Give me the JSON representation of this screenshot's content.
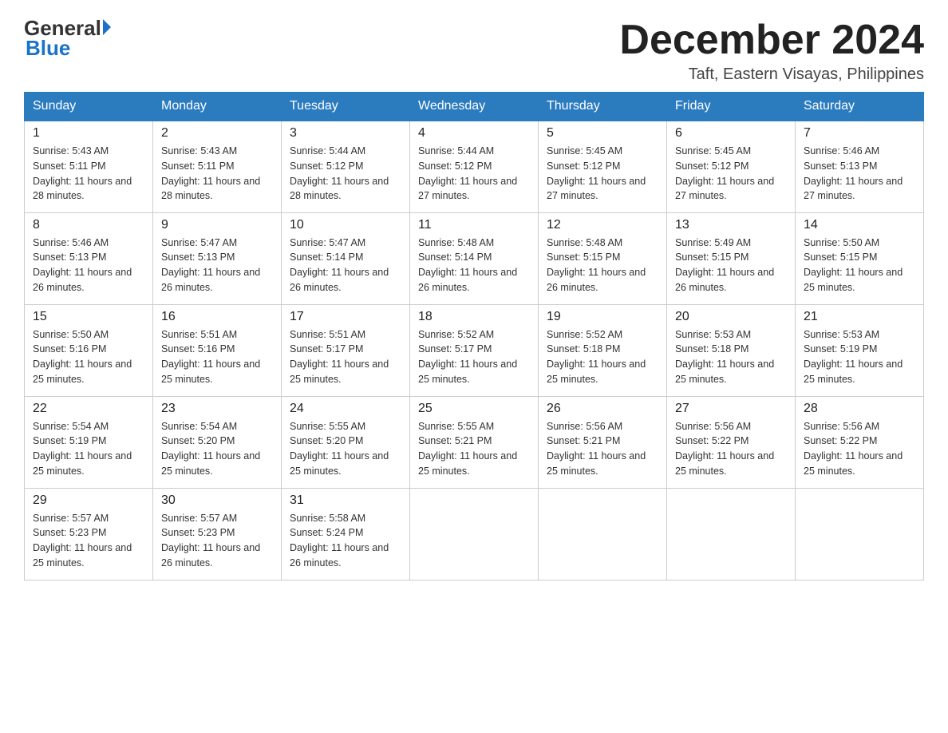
{
  "header": {
    "logo_general": "General",
    "logo_blue": "Blue",
    "month_title": "December 2024",
    "location": "Taft, Eastern Visayas, Philippines"
  },
  "calendar": {
    "days_of_week": [
      "Sunday",
      "Monday",
      "Tuesday",
      "Wednesday",
      "Thursday",
      "Friday",
      "Saturday"
    ],
    "weeks": [
      [
        {
          "day": "1",
          "sunrise": "5:43 AM",
          "sunset": "5:11 PM",
          "daylight": "11 hours and 28 minutes."
        },
        {
          "day": "2",
          "sunrise": "5:43 AM",
          "sunset": "5:11 PM",
          "daylight": "11 hours and 28 minutes."
        },
        {
          "day": "3",
          "sunrise": "5:44 AM",
          "sunset": "5:12 PM",
          "daylight": "11 hours and 28 minutes."
        },
        {
          "day": "4",
          "sunrise": "5:44 AM",
          "sunset": "5:12 PM",
          "daylight": "11 hours and 27 minutes."
        },
        {
          "day": "5",
          "sunrise": "5:45 AM",
          "sunset": "5:12 PM",
          "daylight": "11 hours and 27 minutes."
        },
        {
          "day": "6",
          "sunrise": "5:45 AM",
          "sunset": "5:12 PM",
          "daylight": "11 hours and 27 minutes."
        },
        {
          "day": "7",
          "sunrise": "5:46 AM",
          "sunset": "5:13 PM",
          "daylight": "11 hours and 27 minutes."
        }
      ],
      [
        {
          "day": "8",
          "sunrise": "5:46 AM",
          "sunset": "5:13 PM",
          "daylight": "11 hours and 26 minutes."
        },
        {
          "day": "9",
          "sunrise": "5:47 AM",
          "sunset": "5:13 PM",
          "daylight": "11 hours and 26 minutes."
        },
        {
          "day": "10",
          "sunrise": "5:47 AM",
          "sunset": "5:14 PM",
          "daylight": "11 hours and 26 minutes."
        },
        {
          "day": "11",
          "sunrise": "5:48 AM",
          "sunset": "5:14 PM",
          "daylight": "11 hours and 26 minutes."
        },
        {
          "day": "12",
          "sunrise": "5:48 AM",
          "sunset": "5:15 PM",
          "daylight": "11 hours and 26 minutes."
        },
        {
          "day": "13",
          "sunrise": "5:49 AM",
          "sunset": "5:15 PM",
          "daylight": "11 hours and 26 minutes."
        },
        {
          "day": "14",
          "sunrise": "5:50 AM",
          "sunset": "5:15 PM",
          "daylight": "11 hours and 25 minutes."
        }
      ],
      [
        {
          "day": "15",
          "sunrise": "5:50 AM",
          "sunset": "5:16 PM",
          "daylight": "11 hours and 25 minutes."
        },
        {
          "day": "16",
          "sunrise": "5:51 AM",
          "sunset": "5:16 PM",
          "daylight": "11 hours and 25 minutes."
        },
        {
          "day": "17",
          "sunrise": "5:51 AM",
          "sunset": "5:17 PM",
          "daylight": "11 hours and 25 minutes."
        },
        {
          "day": "18",
          "sunrise": "5:52 AM",
          "sunset": "5:17 PM",
          "daylight": "11 hours and 25 minutes."
        },
        {
          "day": "19",
          "sunrise": "5:52 AM",
          "sunset": "5:18 PM",
          "daylight": "11 hours and 25 minutes."
        },
        {
          "day": "20",
          "sunrise": "5:53 AM",
          "sunset": "5:18 PM",
          "daylight": "11 hours and 25 minutes."
        },
        {
          "day": "21",
          "sunrise": "5:53 AM",
          "sunset": "5:19 PM",
          "daylight": "11 hours and 25 minutes."
        }
      ],
      [
        {
          "day": "22",
          "sunrise": "5:54 AM",
          "sunset": "5:19 PM",
          "daylight": "11 hours and 25 minutes."
        },
        {
          "day": "23",
          "sunrise": "5:54 AM",
          "sunset": "5:20 PM",
          "daylight": "11 hours and 25 minutes."
        },
        {
          "day": "24",
          "sunrise": "5:55 AM",
          "sunset": "5:20 PM",
          "daylight": "11 hours and 25 minutes."
        },
        {
          "day": "25",
          "sunrise": "5:55 AM",
          "sunset": "5:21 PM",
          "daylight": "11 hours and 25 minutes."
        },
        {
          "day": "26",
          "sunrise": "5:56 AM",
          "sunset": "5:21 PM",
          "daylight": "11 hours and 25 minutes."
        },
        {
          "day": "27",
          "sunrise": "5:56 AM",
          "sunset": "5:22 PM",
          "daylight": "11 hours and 25 minutes."
        },
        {
          "day": "28",
          "sunrise": "5:56 AM",
          "sunset": "5:22 PM",
          "daylight": "11 hours and 25 minutes."
        }
      ],
      [
        {
          "day": "29",
          "sunrise": "5:57 AM",
          "sunset": "5:23 PM",
          "daylight": "11 hours and 25 minutes."
        },
        {
          "day": "30",
          "sunrise": "5:57 AM",
          "sunset": "5:23 PM",
          "daylight": "11 hours and 26 minutes."
        },
        {
          "day": "31",
          "sunrise": "5:58 AM",
          "sunset": "5:24 PM",
          "daylight": "11 hours and 26 minutes."
        },
        null,
        null,
        null,
        null
      ]
    ],
    "labels": {
      "sunrise": "Sunrise:",
      "sunset": "Sunset:",
      "daylight": "Daylight:"
    }
  }
}
